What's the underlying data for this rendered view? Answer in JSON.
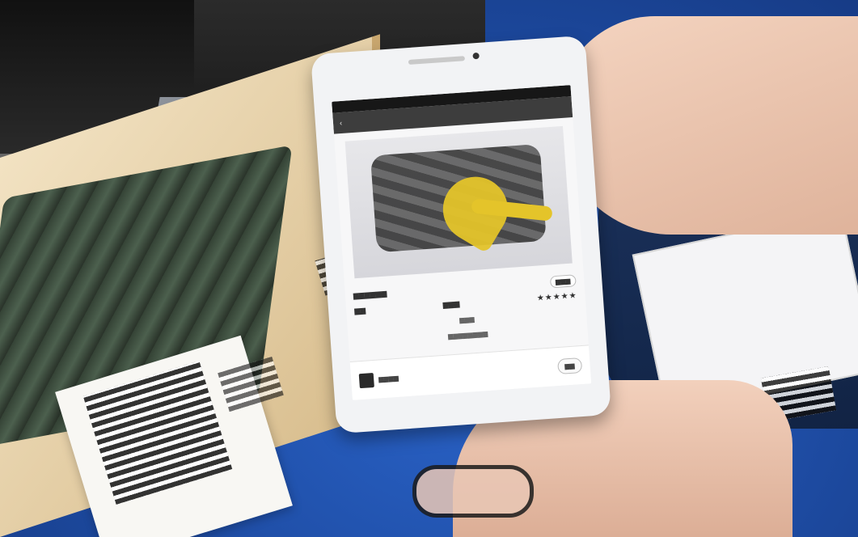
{
  "scene": {
    "colors": {
      "background_blue": "#1f4fa8",
      "tablet_white": "#f2f3f5",
      "ribbon_yellow": "#e4c42a"
    }
  }
}
